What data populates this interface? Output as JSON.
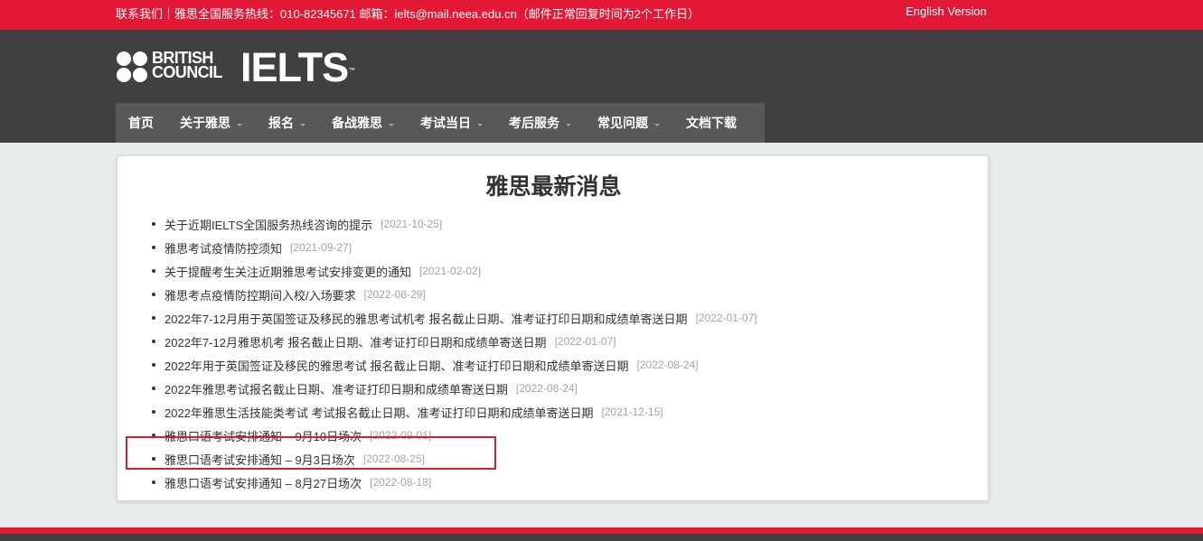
{
  "topbar": {
    "contact": "联系我们｜雅思全国服务热线：010-82345671   邮箱：ielts@mail.neea.edu.cn（邮件正常回复时间为2个工作日）",
    "language": "English Version"
  },
  "logo": {
    "bc_line1": "BRITISH",
    "bc_line2": "COUNCIL",
    "ielts": "IELTS"
  },
  "nav": [
    {
      "label": "首页",
      "dropdown": false
    },
    {
      "label": "关于雅思",
      "dropdown": true
    },
    {
      "label": "报名",
      "dropdown": true
    },
    {
      "label": "备战雅思",
      "dropdown": true
    },
    {
      "label": "考试当日",
      "dropdown": true
    },
    {
      "label": "考后服务",
      "dropdown": true
    },
    {
      "label": "常见问题",
      "dropdown": true
    },
    {
      "label": "文档下载",
      "dropdown": false
    }
  ],
  "news": {
    "heading": "雅思最新消息",
    "items": [
      {
        "title": "关于近期IELTS全国服务热线咨询的提示",
        "date": "[2021-10-25]"
      },
      {
        "title": "雅思考试疫情防控须知",
        "date": "[2021-09-27]"
      },
      {
        "title": "关于提醒考生关注近期雅思考试安排变更的通知",
        "date": "[2021-02-02]"
      },
      {
        "title": "雅思考点疫情防控期间入校/入场要求",
        "date": "[2022-08-29]"
      },
      {
        "title": "2022年7-12月用于英国签证及移民的雅思考试机考 报名截止日期、准考证打印日期和成绩单寄送日期",
        "date": "[2022-01-07]"
      },
      {
        "title": "2022年7-12月雅思机考 报名截止日期、准考证打印日期和成绩单寄送日期",
        "date": "[2022-01-07]"
      },
      {
        "title": "2022年用于英国签证及移民的雅思考试 报名截止日期、准考证打印日期和成绩单寄送日期",
        "date": "[2022-08-24]"
      },
      {
        "title": "2022年雅思考试报名截止日期、准考证打印日期和成绩单寄送日期",
        "date": "[2022-08-24]"
      },
      {
        "title": "2022年雅思生活技能类考试 考试报名截止日期、准考证打印日期和成绩单寄送日期",
        "date": "[2021-12-15]"
      },
      {
        "title": "雅思口语考试安排通知 – 9月10日场次",
        "date": "[2022-09-01]"
      },
      {
        "title": "雅思口语考试安排通知 – 9月3日场次",
        "date": "[2022-08-25]"
      },
      {
        "title": "雅思口语考试安排通知 – 8月27日场次",
        "date": "[2022-08-18]"
      }
    ]
  },
  "colors": {
    "brand_red": "#e31837",
    "header_dark": "#404042",
    "nav_bg": "#58585a",
    "highlight": "#d42024"
  }
}
